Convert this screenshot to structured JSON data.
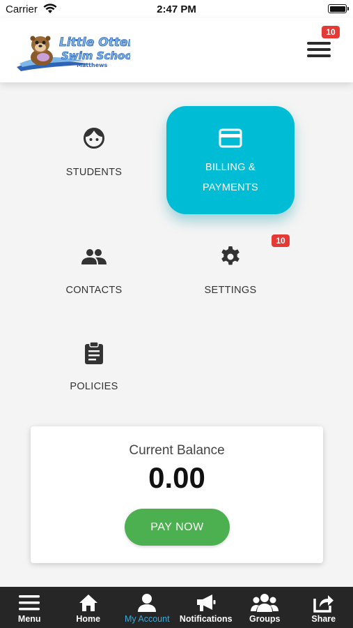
{
  "status_bar": {
    "carrier": "Carrier",
    "time": "2:47 PM"
  },
  "header": {
    "logo": {
      "line1": "Little Otter",
      "line2": "Swim School",
      "line3": "Matthews"
    },
    "menu_badge": "10"
  },
  "grid": {
    "students": {
      "label": "STUDENTS",
      "icon": "face-icon"
    },
    "billing": {
      "label_line1": "BILLING &",
      "label_line2": "PAYMENTS",
      "icon": "credit-card-icon"
    },
    "contacts": {
      "label": "CONTACTS",
      "icon": "people-icon"
    },
    "settings": {
      "label": "SETTINGS",
      "icon": "gear-icon",
      "badge": "10"
    },
    "policies": {
      "label": "POLICIES",
      "icon": "clipboard-icon"
    }
  },
  "balance": {
    "label": "Current Balance",
    "value": "0.00",
    "pay_label": "PAY NOW"
  },
  "tabbar": {
    "items": [
      {
        "label": "Menu",
        "icon": "menu-icon"
      },
      {
        "label": "Home",
        "icon": "home-icon"
      },
      {
        "label": "My Account",
        "icon": "account-icon",
        "active": true
      },
      {
        "label": "Notifications",
        "icon": "megaphone-icon"
      },
      {
        "label": "Groups",
        "icon": "groups-icon"
      },
      {
        "label": "Share",
        "icon": "share-icon"
      }
    ]
  },
  "colors": {
    "accent": "#00bcd4",
    "pay": "#4caf50",
    "badge": "#e53935",
    "tab_active": "#3da9d8",
    "tabbar_bg": "#262626"
  }
}
